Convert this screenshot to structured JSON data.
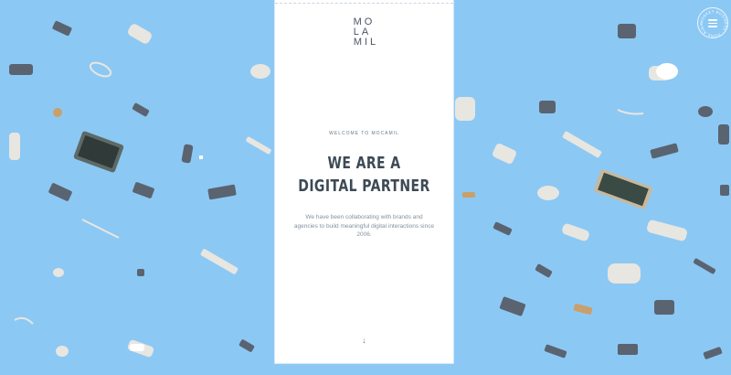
{
  "brand": {
    "logo_line1": "MO",
    "logo_line2": "LA",
    "logo_line3": "MIL"
  },
  "hero": {
    "eyebrow": "WELCOME TO MOCAMIL",
    "headline_line1": "WE ARE A",
    "headline_line2": "DIGITAL PARTNER",
    "description": "We have been collaborating with brands and agencies to build meaningful digital interactions since 2006.",
    "scroll_icon": "arrow-down-icon",
    "scroll_glyph": "↓"
  },
  "badge": {
    "text": "MONKEY BUSINESS · DONE RIGHT ·",
    "icon": "menu-icon"
  },
  "colors": {
    "background": "#8cc8f4",
    "panel": "#ffffff",
    "text_dark": "#3d4a56",
    "text_muted": "#8390a0"
  }
}
